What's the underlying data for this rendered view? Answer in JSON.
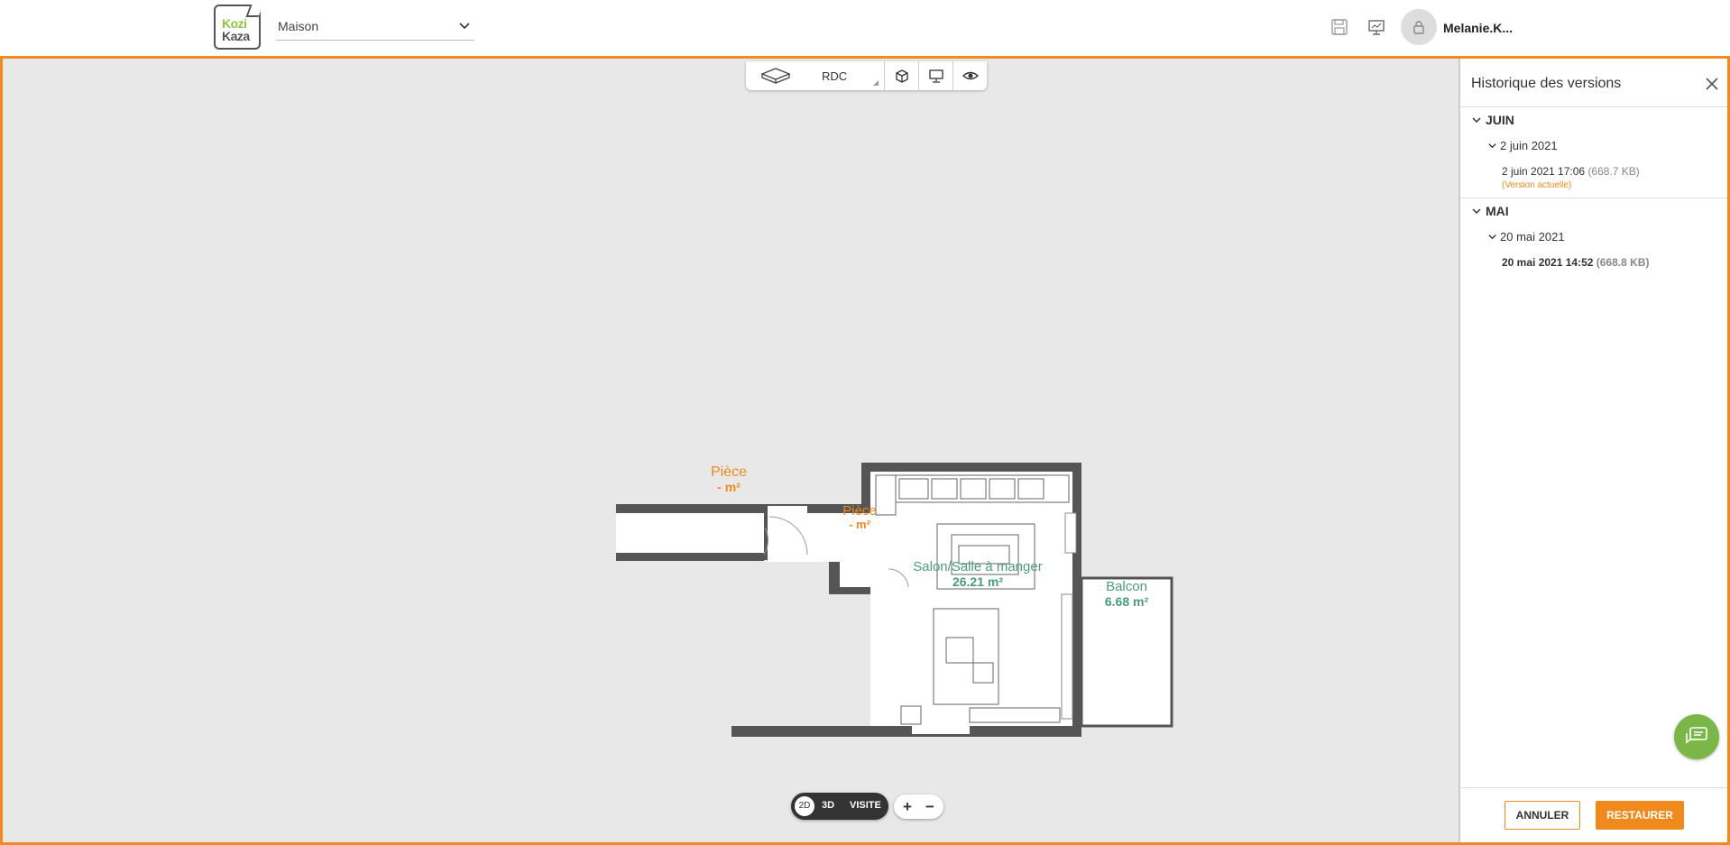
{
  "header": {
    "logo_line1": "Kozi",
    "logo_line2": "Kaza",
    "project_value": "Maison",
    "user_name": "Melanie.K..."
  },
  "toolbar": {
    "level_label": "RDC"
  },
  "viewswitch": {
    "mode_2d": "2D",
    "mode_3d": "3D",
    "mode_visite": "VISITE",
    "zoom_in": "+",
    "zoom_out": "−"
  },
  "floorplan": {
    "rooms": [
      {
        "name": "Pièce",
        "area": "- m²",
        "color": "#f08a1c"
      },
      {
        "name": "Pièce",
        "area": "- m²",
        "color": "#f08a1c"
      },
      {
        "name": "Salon/Salle à manger",
        "area": "26.21 m²",
        "color": "#4a9d7a"
      },
      {
        "name": "Balcon",
        "area": "6.68 m²",
        "color": "#4a9d7a"
      }
    ]
  },
  "panel": {
    "title": "Historique des versions",
    "groups": [
      {
        "month": "JUIN",
        "day": "2 juin 2021",
        "version_time": "2 juin 2021 17:06",
        "version_size": "(668.7 KB)",
        "version_tag": "(Version actuelle)"
      },
      {
        "month": "MAI",
        "day": "20 mai 2021",
        "version_time": "20 mai 2021 14:52",
        "version_size": "(668.8 KB)"
      }
    ],
    "cancel_label": "ANNULER",
    "restore_label": "RESTAURER"
  },
  "colors": {
    "accent": "#f08a1c",
    "chat": "#7ab648"
  }
}
